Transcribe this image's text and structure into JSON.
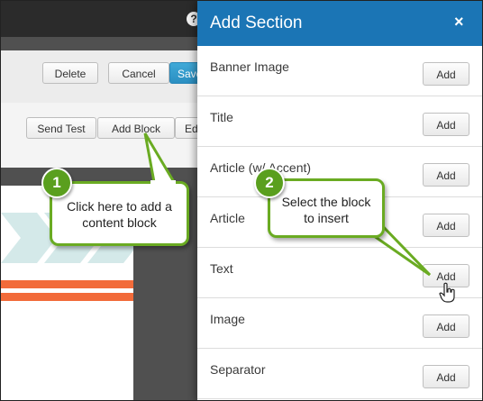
{
  "topbar": {
    "help_icon": "?"
  },
  "toolbar": {
    "delete_label": "Delete",
    "cancel_label": "Cancel",
    "save_label": "Save"
  },
  "actions": {
    "send_test_label": "Send Test",
    "add_block_label": "Add Block",
    "edit_label": "Ed"
  },
  "panel": {
    "title": "Add Section",
    "close_label": "×",
    "items": [
      {
        "label": "Banner Image",
        "button": "Add"
      },
      {
        "label": "Title",
        "button": "Add"
      },
      {
        "label": "Article (w/ Accent)",
        "button": "Add"
      },
      {
        "label": "Article",
        "button": "Add"
      },
      {
        "label": "Text",
        "button": "Add"
      },
      {
        "label": "Image",
        "button": "Add"
      },
      {
        "label": "Separator",
        "button": "Add"
      }
    ]
  },
  "callouts": {
    "one_number": "1",
    "one_text": "Click here to add a content block",
    "two_number": "2",
    "two_text": "Select the block to insert"
  },
  "colors": {
    "panel_header": "#1b75b5",
    "callout_green": "#6aab22",
    "save_blue": "#3fa9d8",
    "accent_orange": "#f26b3a"
  }
}
